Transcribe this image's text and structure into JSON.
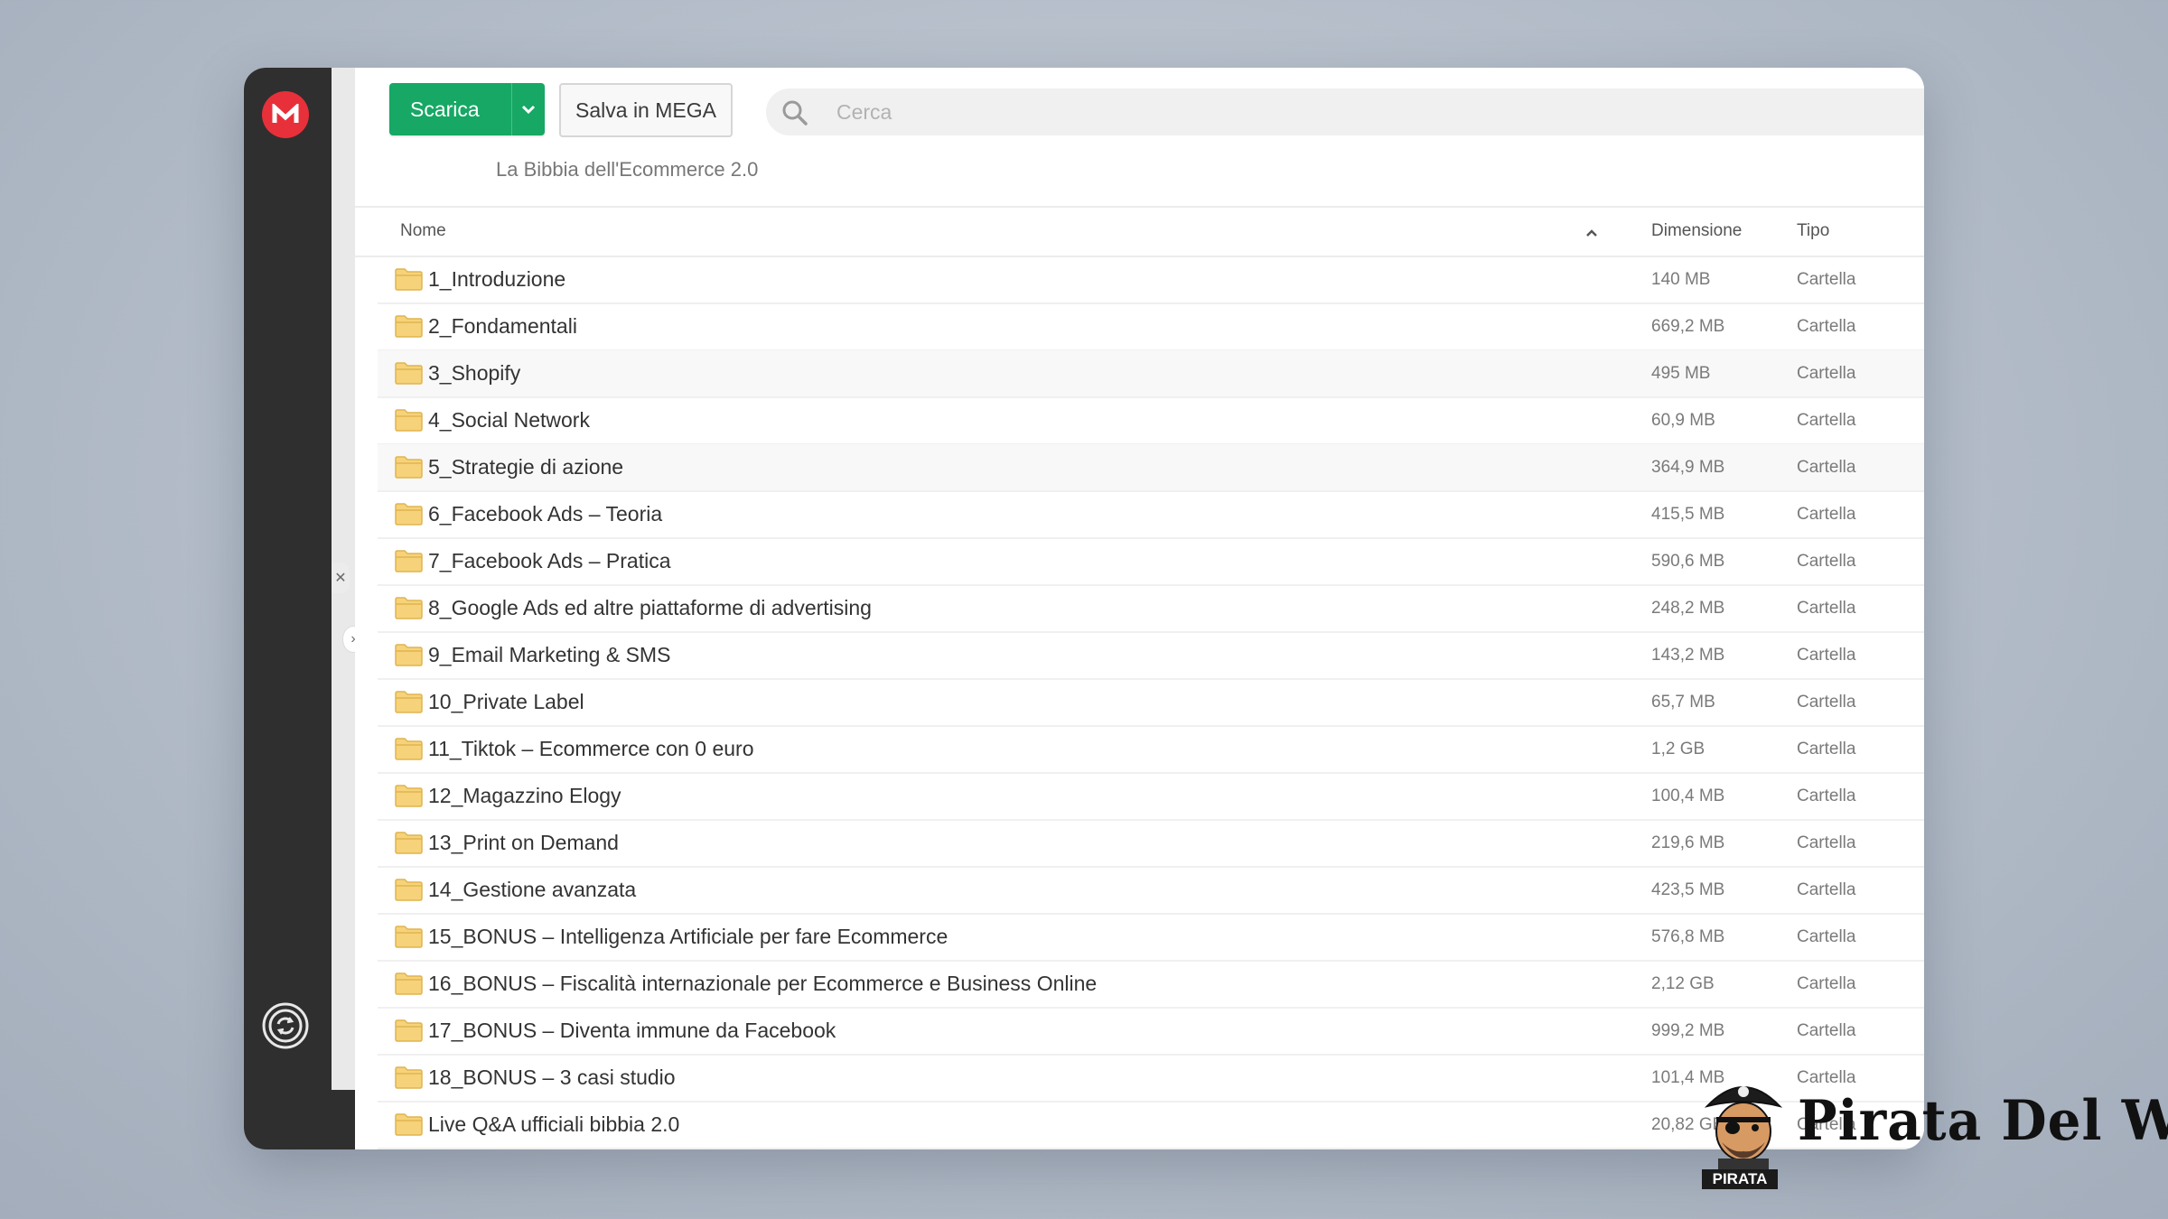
{
  "toolbar": {
    "download_label": "Scarica",
    "save_label": "Salva in MEGA"
  },
  "search": {
    "placeholder": "Cerca"
  },
  "breadcrumb": "La Bibbia dell'Ecommerce 2.0",
  "table": {
    "columns": {
      "name": "Nome",
      "size": "Dimensione",
      "type": "Tipo"
    },
    "rows": [
      {
        "name": "1_Introduzione",
        "size": "140 MB",
        "type": "Cartella"
      },
      {
        "name": "2_Fondamentali",
        "size": "669,2 MB",
        "type": "Cartella"
      },
      {
        "name": "3_Shopify",
        "size": "495 MB",
        "type": "Cartella"
      },
      {
        "name": "4_Social Network",
        "size": "60,9 MB",
        "type": "Cartella"
      },
      {
        "name": "5_Strategie di azione",
        "size": "364,9 MB",
        "type": "Cartella"
      },
      {
        "name": "6_Facebook Ads – Teoria",
        "size": "415,5 MB",
        "type": "Cartella"
      },
      {
        "name": "7_Facebook Ads – Pratica",
        "size": "590,6 MB",
        "type": "Cartella"
      },
      {
        "name": "8_Google Ads ed altre piattaforme di advertising",
        "size": "248,2 MB",
        "type": "Cartella"
      },
      {
        "name": "9_Email Marketing & SMS",
        "size": "143,2 MB",
        "type": "Cartella"
      },
      {
        "name": "10_Private Label",
        "size": "65,7 MB",
        "type": "Cartella"
      },
      {
        "name": "11_Tiktok – Ecommerce con 0 euro",
        "size": "1,2 GB",
        "type": "Cartella"
      },
      {
        "name": "12_Magazzino Elogy",
        "size": "100,4 MB",
        "type": "Cartella"
      },
      {
        "name": "13_Print on Demand",
        "size": "219,6 MB",
        "type": "Cartella"
      },
      {
        "name": "14_Gestione avanzata",
        "size": "423,5 MB",
        "type": "Cartella"
      },
      {
        "name": "15_BONUS – Intelligenza Artificiale per fare Ecommerce",
        "size": "576,8 MB",
        "type": "Cartella"
      },
      {
        "name": "16_BONUS – Fiscalità internazionale per Ecommerce e Business Online",
        "size": "2,12 GB",
        "type": "Cartella"
      },
      {
        "name": "17_BONUS – Diventa immune da Facebook",
        "size": "999,2 MB",
        "type": "Cartella"
      },
      {
        "name": "18_BONUS – 3 casi studio",
        "size": "101,4 MB",
        "type": "Cartella"
      },
      {
        "name": "Live Q&A ufficiali bibbia 2.0",
        "size": "20,82 GB",
        "type": "Cartella"
      }
    ]
  },
  "watermark": {
    "text": "Pirata Del Web",
    "badge": "PIRATA"
  },
  "colors": {
    "accent": "#16a864",
    "brand": "#e8303a",
    "folder": "#f6d37a"
  },
  "icons": [
    "mega-logo-icon",
    "sync-icon",
    "search-icon",
    "chevron-down-icon",
    "sort-up-icon",
    "folder-icon",
    "close-icon",
    "chevron-right-icon"
  ]
}
